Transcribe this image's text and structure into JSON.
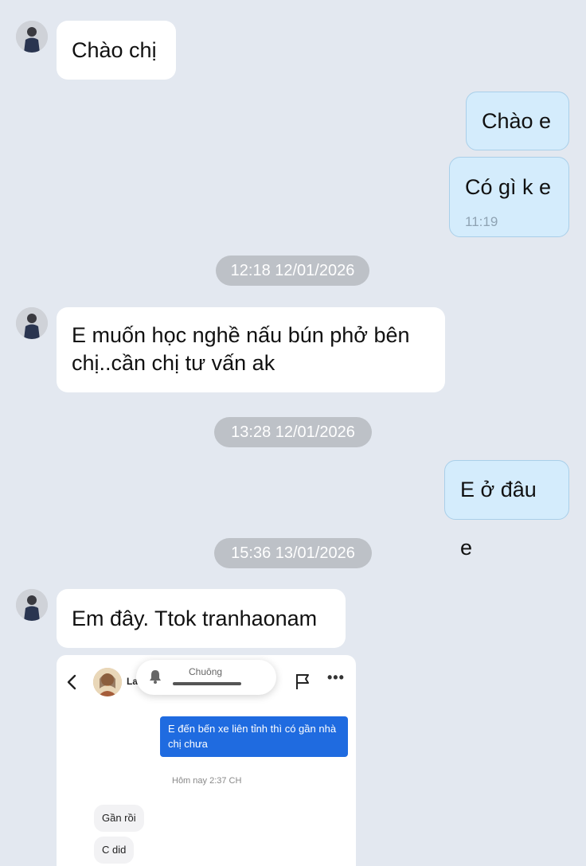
{
  "messages": [
    {
      "text": "Chào chị"
    },
    {
      "text": "Chào e"
    },
    {
      "text": "Có gì k e",
      "time": "11:19"
    },
    {
      "text_line1": "E muốn học nghề nấu bún phở bên",
      "text_line2": "chị..cần chị tư vấn ak"
    },
    {
      "text": "E ở đâu e"
    },
    {
      "text": "Em đây. Ttok tranhaonam"
    }
  ],
  "timestamps": [
    "12:18 12/01/2026",
    "13:28 12/01/2026",
    "15:36 13/01/2026"
  ],
  "embedded": {
    "contact_name_partial": "La",
    "notification_label": "Chuông",
    "outgoing_message": "E đến bến xe liên tỉnh thì có gần nhà chị chưa",
    "time_label": "Hôm nay 2:37 CH",
    "incoming_messages": [
      "Gần rồi",
      "C did"
    ],
    "icons": [
      "back-chevron-icon",
      "bell-icon",
      "flag-icon",
      "more-icon"
    ]
  },
  "colors": {
    "background": "#e3e8f0",
    "incoming_bubble": "#ffffff",
    "outgoing_bubble": "#d4ecfc",
    "timestamp_pill": "#bdc1c7",
    "embedded_outgoing": "#1f6be0"
  }
}
